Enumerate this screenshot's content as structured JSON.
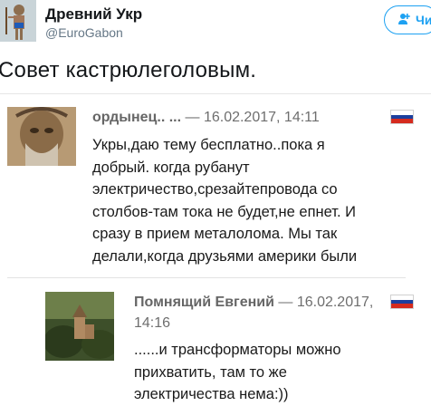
{
  "tweet": {
    "display_name": "Древний Укр",
    "handle": "@EuroGabon",
    "follow_label": "Чи",
    "text": "Совет кастрюлеголовым."
  },
  "comments": [
    {
      "author": "ордынец.. ...",
      "date": "— 16.02.2017, 14:11",
      "text_lines": [
        "Укры,даю тему бесплатно..пока я",
        "добрый. когда рубанут",
        "электричество,срезайтепровода со",
        "столбов-там тока не будет,не епнет. И",
        "сразу в прием металолома. Мы так",
        "делали,когда друзьями америки были"
      ]
    },
    {
      "author": "Помнящий Евгений",
      "date": "— 16.02.2017,",
      "date_line2": "14:16",
      "text_lines": [
        "......и трансформаторы можно",
        "прихватить, там то же",
        "электричества нема:))"
      ]
    }
  ],
  "colors": {
    "follow_blue": "#1da1f2",
    "flag_white": "#ffffff",
    "flag_blue": "#1c3f9e",
    "flag_red": "#d52b1e"
  },
  "icons": {
    "follow": "add-user-icon",
    "flag": "russia-flag-icon"
  }
}
